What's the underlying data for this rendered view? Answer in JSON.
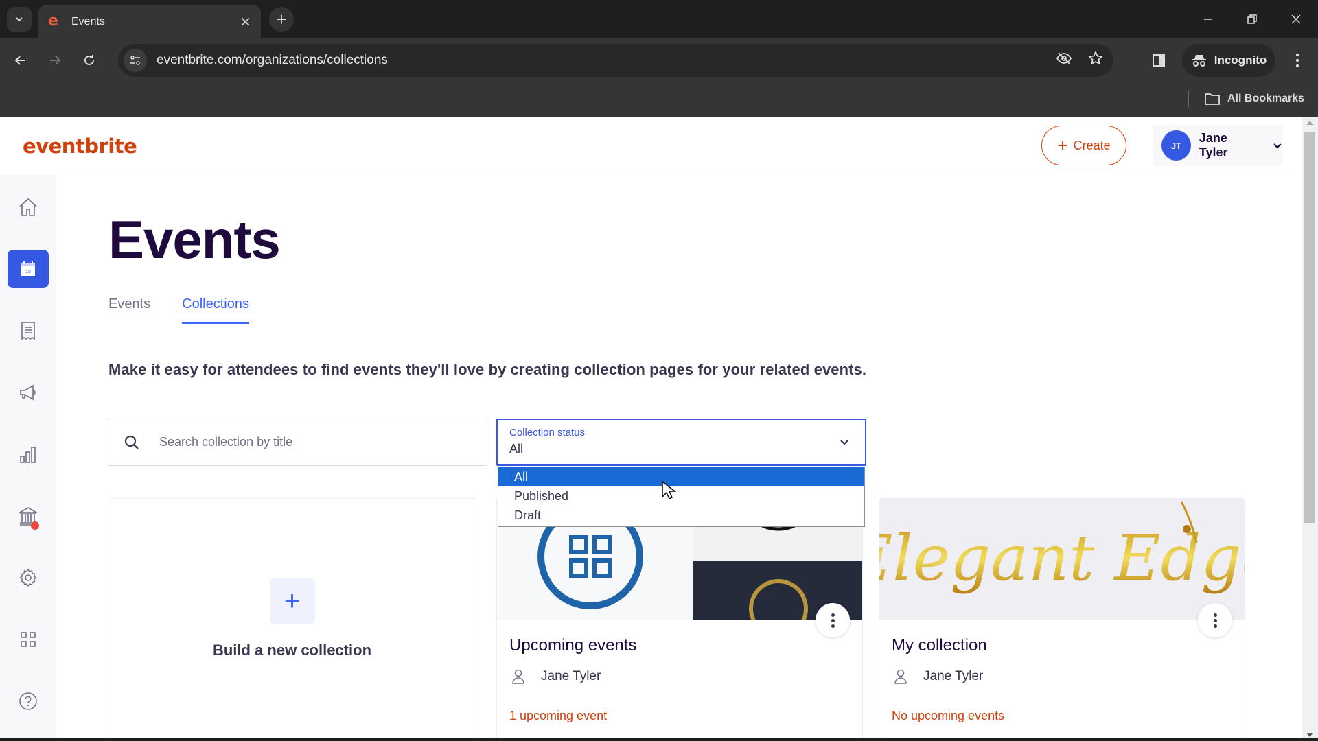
{
  "browser": {
    "tab_title": "Events",
    "url": "eventbrite.com/organizations/collections",
    "profile_label": "Incognito",
    "bookmarks_label": "All Bookmarks"
  },
  "header": {
    "logo": "eventbrite",
    "create_label": "Create",
    "user_initials": "JT",
    "user_name": "Jane Tyler",
    "brand_color": "#d1410c",
    "accent_color": "#3659e3"
  },
  "sidebar": {
    "items": [
      {
        "name": "home",
        "icon": "home-icon",
        "active": false
      },
      {
        "name": "events",
        "icon": "calendar-icon",
        "active": true,
        "calendar_day": "15"
      },
      {
        "name": "orders",
        "icon": "receipt-icon",
        "active": false
      },
      {
        "name": "marketing",
        "icon": "megaphone-icon",
        "active": false
      },
      {
        "name": "reports",
        "icon": "bar-chart-icon",
        "active": false
      },
      {
        "name": "finance",
        "icon": "bank-icon",
        "active": false,
        "notification": true
      },
      {
        "name": "settings",
        "icon": "gear-icon",
        "active": false
      },
      {
        "name": "apps",
        "icon": "apps-grid-icon",
        "active": false
      },
      {
        "name": "help",
        "icon": "help-icon",
        "active": false
      }
    ]
  },
  "main": {
    "title": "Events",
    "tabs": [
      {
        "label": "Events",
        "active": false
      },
      {
        "label": "Collections",
        "active": true
      }
    ],
    "description": "Make it easy for attendees to find events they'll love by creating collection pages for your related events.",
    "search": {
      "placeholder": "Search collection by title",
      "value": ""
    },
    "status_select": {
      "label": "Collection status",
      "value": "All",
      "options": [
        "All",
        "Published",
        "Draft"
      ],
      "highlighted": "All",
      "open": true
    },
    "new_collection_label": "Build a new collection",
    "collections": [
      {
        "title": "Upcoming events",
        "owner": "Jane Tyler",
        "status": "1 upcoming event"
      },
      {
        "title": "My collection",
        "owner": "Jane Tyler",
        "status": "No upcoming events",
        "image_text": "Elegant Edge"
      }
    ]
  }
}
